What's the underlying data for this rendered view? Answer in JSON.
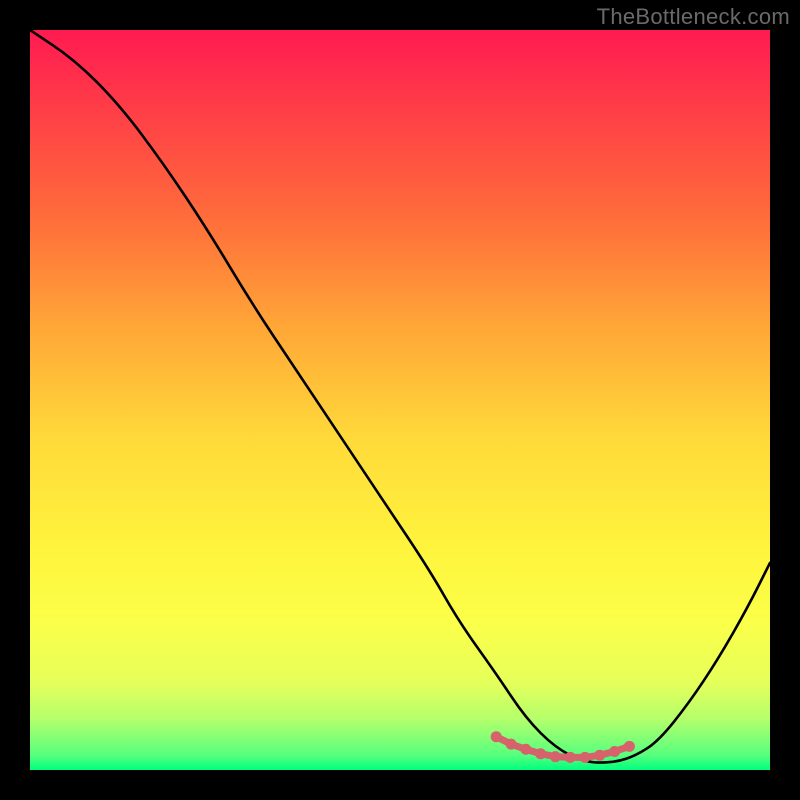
{
  "watermark": "TheBottleneck.com",
  "chart_data": {
    "type": "line",
    "title": "",
    "xlabel": "",
    "ylabel": "",
    "xlim": [
      0,
      100
    ],
    "ylim": [
      0,
      100
    ],
    "legend": false,
    "grid": false,
    "series": [
      {
        "name": "bottleneck-curve",
        "color": "#000000",
        "x": [
          0,
          6,
          12,
          18,
          24,
          30,
          36,
          42,
          48,
          54,
          58,
          63,
          67,
          71,
          75,
          79,
          82,
          85,
          89,
          93,
          97,
          100
        ],
        "y": [
          100,
          96,
          90,
          82,
          73,
          63,
          54,
          45,
          36,
          27,
          20,
          13,
          7,
          3,
          1,
          1,
          2,
          4,
          9,
          15,
          22,
          28
        ]
      },
      {
        "name": "valley-markers",
        "color": "#d6626b",
        "type": "scatter",
        "x": [
          63,
          65,
          67,
          69,
          71,
          73,
          75,
          77,
          79,
          81
        ],
        "y": [
          4.5,
          3.5,
          2.8,
          2.2,
          1.8,
          1.7,
          1.7,
          2.0,
          2.5,
          3.2
        ]
      }
    ],
    "background_gradient": {
      "orientation": "vertical",
      "stops": [
        {
          "pos": 0.0,
          "color": "#ff1a51"
        },
        {
          "pos": 0.25,
          "color": "#ff6b3b"
        },
        {
          "pos": 0.55,
          "color": "#ffd93a"
        },
        {
          "pos": 0.8,
          "color": "#fbff49"
        },
        {
          "pos": 0.95,
          "color": "#8aff72"
        },
        {
          "pos": 1.0,
          "color": "#00ff7e"
        }
      ]
    }
  }
}
